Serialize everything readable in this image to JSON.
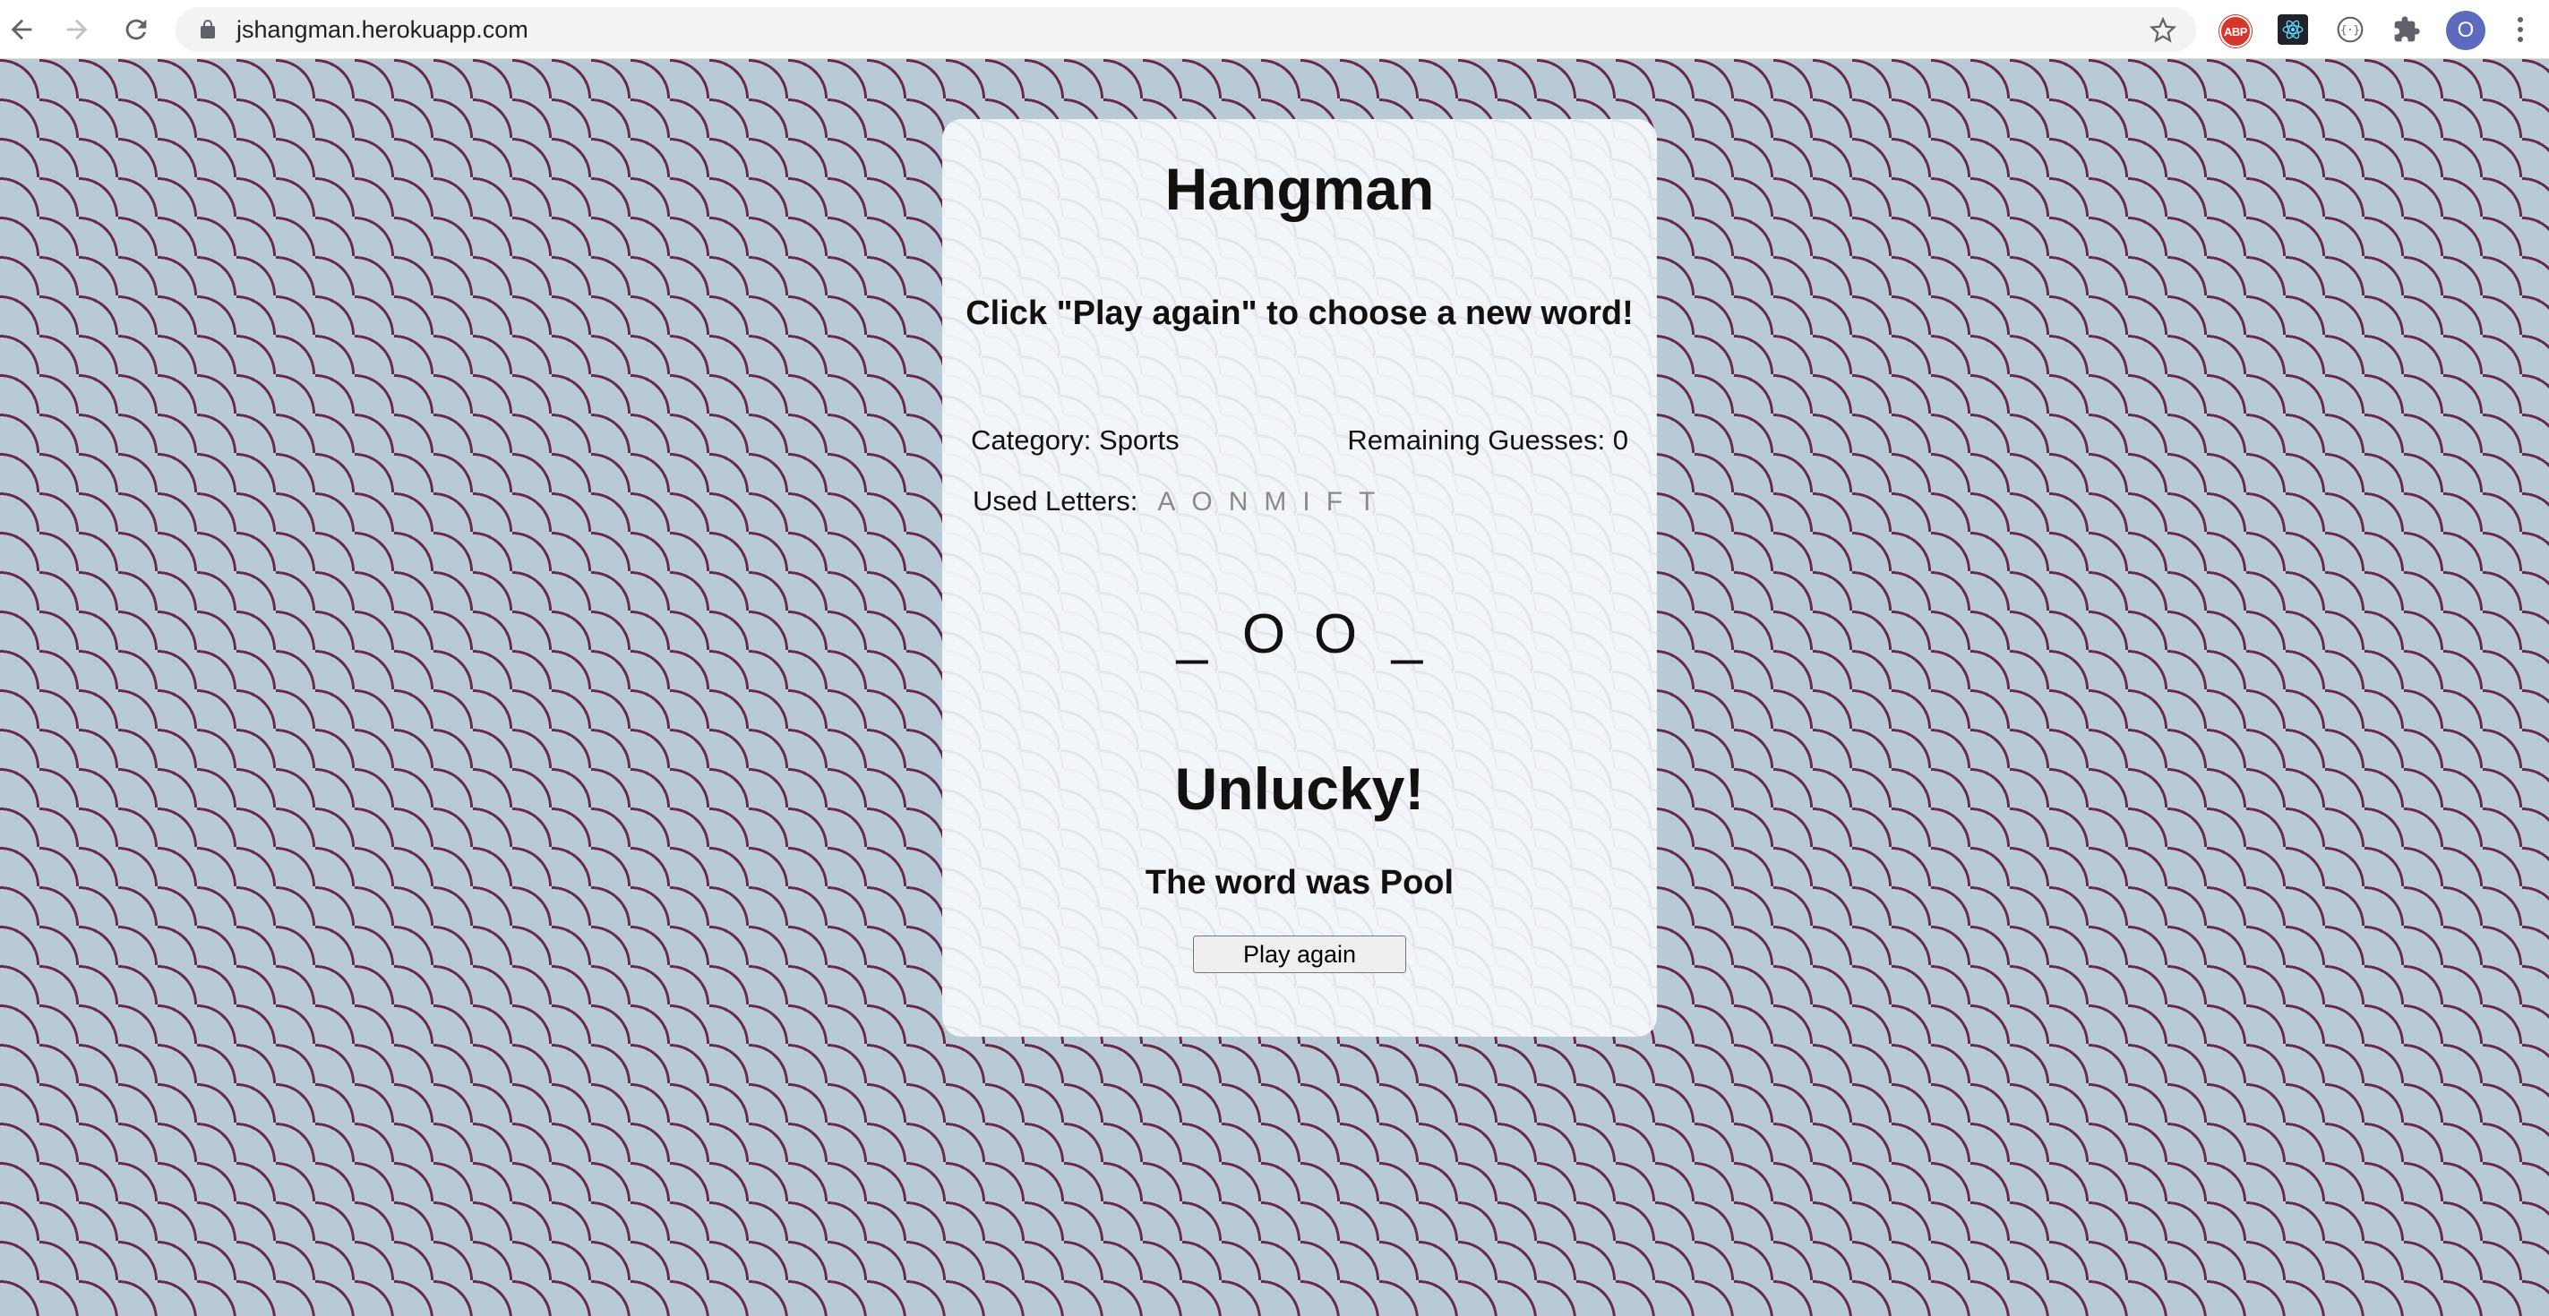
{
  "browser": {
    "url": "jshangman.herokuapp.com",
    "back_icon": "arrow-left-icon",
    "forward_icon": "arrow-right-icon",
    "reload_icon": "reload-icon",
    "extensions": {
      "abp_label": "ABP",
      "avatar_initial": "O"
    }
  },
  "game": {
    "title": "Hangman",
    "prompt": "Click \"Play again\" to choose a new word!",
    "category_label": "Category: Sports",
    "remaining_label": "Remaining Guesses: 0",
    "used_letters_label": "Used Letters:",
    "used_letters": [
      "A",
      "O",
      "N",
      "M",
      "I",
      "F",
      "T"
    ],
    "word_slots": [
      "_",
      "O",
      "O",
      "_"
    ],
    "result": "Unlucky!",
    "reveal": "The word was Pool",
    "play_again_label": "Play again"
  },
  "colors": {
    "page_background": "#b7cad6",
    "pattern_stroke": "#6a2a4a",
    "card_background": "#f6f8fb",
    "used_letter_color": "#8a8a8a"
  }
}
